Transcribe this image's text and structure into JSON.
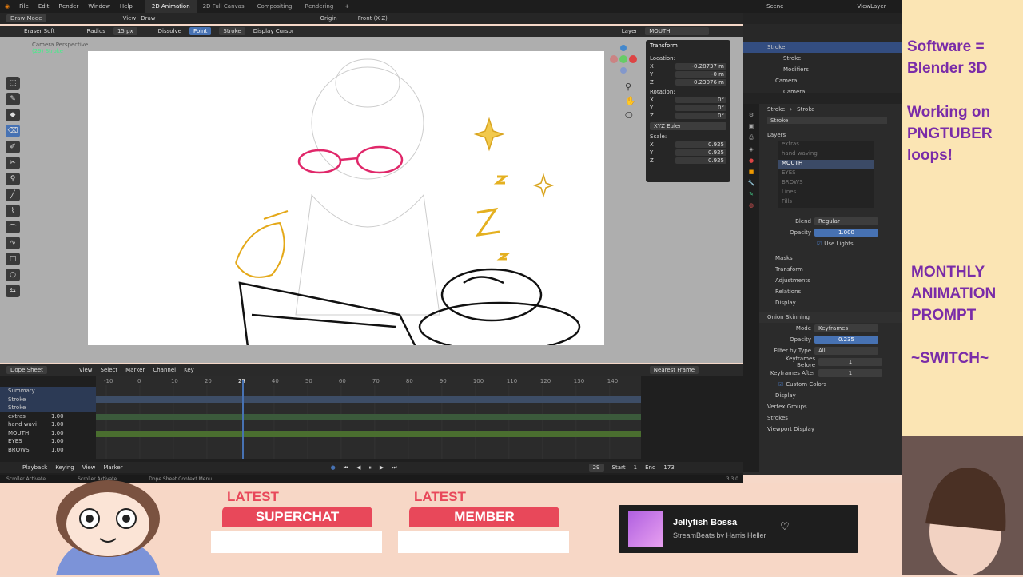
{
  "topbar": {
    "menus": [
      "File",
      "Edit",
      "Render",
      "Window",
      "Help"
    ],
    "workspaces": [
      "2D Animation",
      "2D Full Canvas",
      "Compositing",
      "Rendering"
    ],
    "scene": "Scene",
    "view_layer": "ViewLayer"
  },
  "header2": {
    "mode": "Draw Mode",
    "view": "View",
    "draw": "Draw",
    "origin": "Origin",
    "front": "Front (X-Z)"
  },
  "header3": {
    "brush": "Eraser Soft",
    "radius_label": "Radius",
    "radius_value": "15 px",
    "dissolve": "Dissolve",
    "point": "Point",
    "stroke": "Stroke",
    "display_cursor": "Display Cursor",
    "layer_label": "Layer",
    "layer_value": "MOUTH"
  },
  "viewport": {
    "camera_label": "Camera Perspective",
    "sub_label": "(29) Stroke"
  },
  "transform": {
    "title": "Transform",
    "location_label": "Location:",
    "loc": [
      "X",
      "Y",
      "Z"
    ],
    "loc_vals": [
      "-0.28737 m",
      "-0 m",
      "0.23076 m"
    ],
    "rotation_label": "Rotation:",
    "rot_vals": [
      "0°",
      "0°",
      "0°"
    ],
    "euler": "XYZ Euler",
    "scale_label": "Scale:",
    "scale_vals": [
      "0.925",
      "0.925",
      "0.925"
    ]
  },
  "dope": {
    "editor": "Dope Sheet",
    "menus": [
      "View",
      "Select",
      "Marker",
      "Channel",
      "Key"
    ],
    "interp": "Nearest Frame",
    "frames": [
      "-10",
      "0",
      "10",
      "20",
      "29",
      "40",
      "50",
      "60",
      "70",
      "80",
      "90",
      "100",
      "110",
      "120",
      "130",
      "140"
    ],
    "channels": [
      {
        "name": "Summary",
        "val": ""
      },
      {
        "name": "Stroke",
        "val": ""
      },
      {
        "name": "Stroke",
        "val": ""
      },
      {
        "name": "extras",
        "val": "1.00"
      },
      {
        "name": "hand wavi",
        "val": "1.00"
      },
      {
        "name": "MOUTH",
        "val": "1.00"
      },
      {
        "name": "EYES",
        "val": "1.00"
      },
      {
        "name": "BROWS",
        "val": "1.00"
      }
    ],
    "playback": "Playback",
    "keying": "Keying",
    "view": "View",
    "marker": "Marker",
    "current_frame": "29",
    "start_label": "Start",
    "start": "1",
    "end_label": "End",
    "end": "173"
  },
  "status": {
    "a": "Scroller Activate",
    "b": "Scroller Activate",
    "c": "Dope Sheet Context Menu",
    "version": "3.3.0"
  },
  "outliner": {
    "items": [
      "Stroke",
      "Stroke",
      "Modifiers",
      "Camera",
      "Camera"
    ]
  },
  "props": {
    "breadcrumb_a": "Stroke",
    "breadcrumb_b": "Stroke",
    "object": "Stroke",
    "layers_title": "Layers",
    "layers": [
      "extras",
      "hand waving",
      "MOUTH",
      "EYES",
      "BROWS",
      "Lines",
      "Fills"
    ],
    "blend_label": "Blend",
    "blend_value": "Regular",
    "opacity_label": "Opacity",
    "opacity_value": "1.000",
    "use_lights": "Use Lights",
    "sections": [
      "Masks",
      "Transform",
      "Adjustments",
      "Relations",
      "Display"
    ],
    "onion": "Onion Skinning",
    "mode_label": "Mode",
    "mode_value": "Keyframes",
    "onion_opacity_label": "Opacity",
    "onion_opacity_value": "0.235",
    "filter_label": "Filter by Type",
    "filter_value": "All",
    "kf_before_label": "Keyframes Before",
    "kf_before": "1",
    "kf_after_label": "Keyframes After",
    "kf_after": "1",
    "custom_colors": "Custom Colors",
    "display2": "Display",
    "vertex_groups": "Vertex Groups",
    "strokes": "Strokes",
    "viewport_display": "Viewport Display"
  },
  "overlay": {
    "line1": "Software =",
    "line2": "Blender 3D",
    "line3": "Working on",
    "line4": "PNGTUBER",
    "line5": "loops!",
    "line6": "MONTHLY",
    "line7": "ANIMATION",
    "line8": "PROMPT",
    "line9": "~SWITCH~"
  },
  "bottom": {
    "latest1": "LATEST",
    "superchat": "SUPERCHAT",
    "latest2": "LATEST",
    "member": "MEMBER",
    "song": "Jellyfish Bossa",
    "artist": "StreamBeats by Harris Heller"
  }
}
